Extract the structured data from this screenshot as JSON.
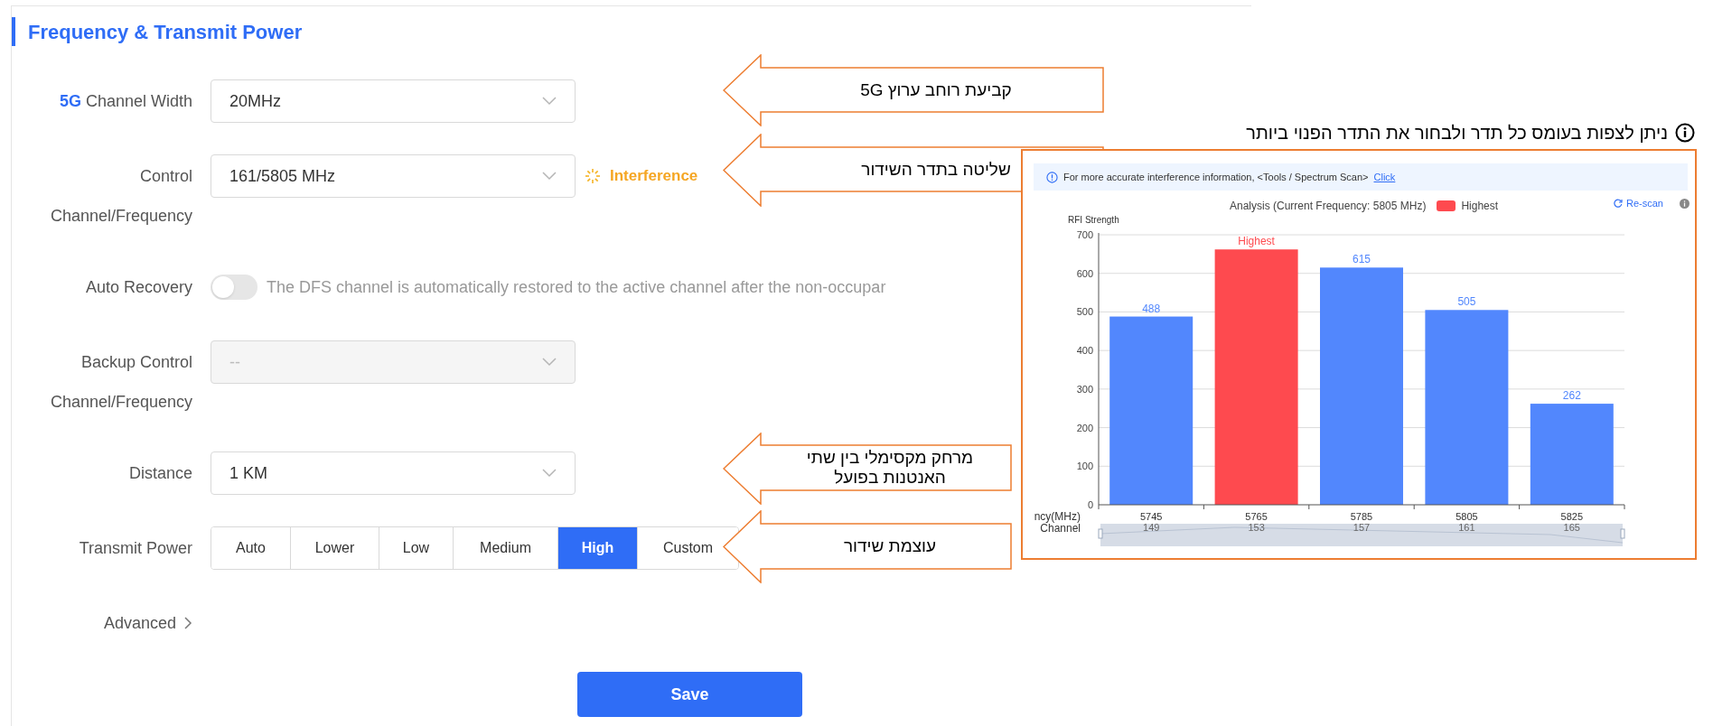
{
  "section_title": "Frequency & Transmit Power",
  "rows": [
    {
      "kind": "select",
      "label_accent": "5G",
      "label": "Channel Width",
      "value": "20MHz",
      "disabled": false
    },
    {
      "kind": "select",
      "label": "Control",
      "label_line2": "Channel/Frequency",
      "value": "161/5805 MHz",
      "disabled": false,
      "status": "Interference"
    },
    {
      "kind": "toggle",
      "label": "Auto Recovery",
      "on": false,
      "description": "The DFS channel is automatically restored to the active channel after the non-occupar"
    },
    {
      "kind": "select",
      "label": "Backup Control",
      "label_line2": "Channel/Frequency",
      "value": "--",
      "disabled": true
    },
    {
      "kind": "select",
      "label": "Distance",
      "value": "1 KM",
      "disabled": false
    },
    {
      "kind": "segmented",
      "label": "Transmit Power",
      "options": [
        {
          "label": "Auto",
          "selected": false
        },
        {
          "label": "Lower",
          "selected": false
        },
        {
          "label": "Low",
          "selected": false
        },
        {
          "label": "Medium",
          "selected": false
        },
        {
          "label": "High",
          "selected": true
        },
        {
          "label": "Custom",
          "selected": false
        }
      ]
    },
    {
      "kind": "link",
      "label": "Advanced"
    }
  ],
  "save_button": "Save",
  "callouts": [
    {
      "text": "קביעת רוחב ערוץ 5G"
    },
    {
      "text": "שליטה בתדר השידור"
    },
    {
      "text": "מרחק מקסימלי בין שתי האנטנות בפועל"
    },
    {
      "text": "עוצמת שידור"
    }
  ],
  "chart_note": "ניתן לצפות בעומס כל תדר ולבחור את התדר הפנוי ביותר",
  "spectrum_panel": {
    "notice": "For more accurate interference information, <Tools / Spectrum Scan>",
    "notice_link": "Click",
    "title": "Analysis (Current Frequency: 5805 MHz)",
    "rescan": "Re-scan",
    "channel_axis": {
      "label": "Channel",
      "values": [
        "149",
        "153",
        "157",
        "161",
        "165"
      ]
    },
    "chart_data": {
      "type": "bar",
      "ylabel": "RFI Strength",
      "xlabel": "ncy(MHz)",
      "categories": [
        "5745",
        "5765",
        "5785",
        "5805",
        "5825"
      ],
      "series": [
        {
          "color": "#5287fd",
          "values": [
            488,
            null,
            615,
            505,
            262
          ]
        },
        {
          "name": "Highest",
          "color": "#fe4a4f",
          "values": [
            null,
            662,
            null,
            null,
            null
          ]
        }
      ],
      "stacked": true,
      "grid": true,
      "ylim": [
        0,
        700
      ],
      "yticks": [
        0,
        100,
        200,
        300,
        400,
        500,
        600,
        700
      ],
      "value_labels": [
        "488",
        "Highest",
        "615",
        "505",
        "262"
      ]
    }
  }
}
